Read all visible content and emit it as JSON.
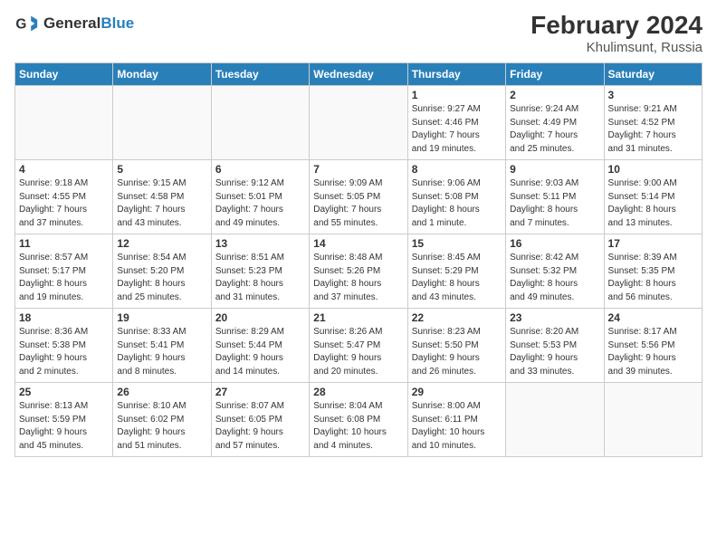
{
  "header": {
    "logo_line1": "General",
    "logo_line2": "Blue",
    "month": "February 2024",
    "location": "Khulimsunt, Russia"
  },
  "days_of_week": [
    "Sunday",
    "Monday",
    "Tuesday",
    "Wednesday",
    "Thursday",
    "Friday",
    "Saturday"
  ],
  "weeks": [
    [
      {
        "num": "",
        "info": ""
      },
      {
        "num": "",
        "info": ""
      },
      {
        "num": "",
        "info": ""
      },
      {
        "num": "",
        "info": ""
      },
      {
        "num": "1",
        "info": "Sunrise: 9:27 AM\nSunset: 4:46 PM\nDaylight: 7 hours\nand 19 minutes."
      },
      {
        "num": "2",
        "info": "Sunrise: 9:24 AM\nSunset: 4:49 PM\nDaylight: 7 hours\nand 25 minutes."
      },
      {
        "num": "3",
        "info": "Sunrise: 9:21 AM\nSunset: 4:52 PM\nDaylight: 7 hours\nand 31 minutes."
      }
    ],
    [
      {
        "num": "4",
        "info": "Sunrise: 9:18 AM\nSunset: 4:55 PM\nDaylight: 7 hours\nand 37 minutes."
      },
      {
        "num": "5",
        "info": "Sunrise: 9:15 AM\nSunset: 4:58 PM\nDaylight: 7 hours\nand 43 minutes."
      },
      {
        "num": "6",
        "info": "Sunrise: 9:12 AM\nSunset: 5:01 PM\nDaylight: 7 hours\nand 49 minutes."
      },
      {
        "num": "7",
        "info": "Sunrise: 9:09 AM\nSunset: 5:05 PM\nDaylight: 7 hours\nand 55 minutes."
      },
      {
        "num": "8",
        "info": "Sunrise: 9:06 AM\nSunset: 5:08 PM\nDaylight: 8 hours\nand 1 minute."
      },
      {
        "num": "9",
        "info": "Sunrise: 9:03 AM\nSunset: 5:11 PM\nDaylight: 8 hours\nand 7 minutes."
      },
      {
        "num": "10",
        "info": "Sunrise: 9:00 AM\nSunset: 5:14 PM\nDaylight: 8 hours\nand 13 minutes."
      }
    ],
    [
      {
        "num": "11",
        "info": "Sunrise: 8:57 AM\nSunset: 5:17 PM\nDaylight: 8 hours\nand 19 minutes."
      },
      {
        "num": "12",
        "info": "Sunrise: 8:54 AM\nSunset: 5:20 PM\nDaylight: 8 hours\nand 25 minutes."
      },
      {
        "num": "13",
        "info": "Sunrise: 8:51 AM\nSunset: 5:23 PM\nDaylight: 8 hours\nand 31 minutes."
      },
      {
        "num": "14",
        "info": "Sunrise: 8:48 AM\nSunset: 5:26 PM\nDaylight: 8 hours\nand 37 minutes."
      },
      {
        "num": "15",
        "info": "Sunrise: 8:45 AM\nSunset: 5:29 PM\nDaylight: 8 hours\nand 43 minutes."
      },
      {
        "num": "16",
        "info": "Sunrise: 8:42 AM\nSunset: 5:32 PM\nDaylight: 8 hours\nand 49 minutes."
      },
      {
        "num": "17",
        "info": "Sunrise: 8:39 AM\nSunset: 5:35 PM\nDaylight: 8 hours\nand 56 minutes."
      }
    ],
    [
      {
        "num": "18",
        "info": "Sunrise: 8:36 AM\nSunset: 5:38 PM\nDaylight: 9 hours\nand 2 minutes."
      },
      {
        "num": "19",
        "info": "Sunrise: 8:33 AM\nSunset: 5:41 PM\nDaylight: 9 hours\nand 8 minutes."
      },
      {
        "num": "20",
        "info": "Sunrise: 8:29 AM\nSunset: 5:44 PM\nDaylight: 9 hours\nand 14 minutes."
      },
      {
        "num": "21",
        "info": "Sunrise: 8:26 AM\nSunset: 5:47 PM\nDaylight: 9 hours\nand 20 minutes."
      },
      {
        "num": "22",
        "info": "Sunrise: 8:23 AM\nSunset: 5:50 PM\nDaylight: 9 hours\nand 26 minutes."
      },
      {
        "num": "23",
        "info": "Sunrise: 8:20 AM\nSunset: 5:53 PM\nDaylight: 9 hours\nand 33 minutes."
      },
      {
        "num": "24",
        "info": "Sunrise: 8:17 AM\nSunset: 5:56 PM\nDaylight: 9 hours\nand 39 minutes."
      }
    ],
    [
      {
        "num": "25",
        "info": "Sunrise: 8:13 AM\nSunset: 5:59 PM\nDaylight: 9 hours\nand 45 minutes."
      },
      {
        "num": "26",
        "info": "Sunrise: 8:10 AM\nSunset: 6:02 PM\nDaylight: 9 hours\nand 51 minutes."
      },
      {
        "num": "27",
        "info": "Sunrise: 8:07 AM\nSunset: 6:05 PM\nDaylight: 9 hours\nand 57 minutes."
      },
      {
        "num": "28",
        "info": "Sunrise: 8:04 AM\nSunset: 6:08 PM\nDaylight: 10 hours\nand 4 minutes."
      },
      {
        "num": "29",
        "info": "Sunrise: 8:00 AM\nSunset: 6:11 PM\nDaylight: 10 hours\nand 10 minutes."
      },
      {
        "num": "",
        "info": ""
      },
      {
        "num": "",
        "info": ""
      }
    ]
  ]
}
